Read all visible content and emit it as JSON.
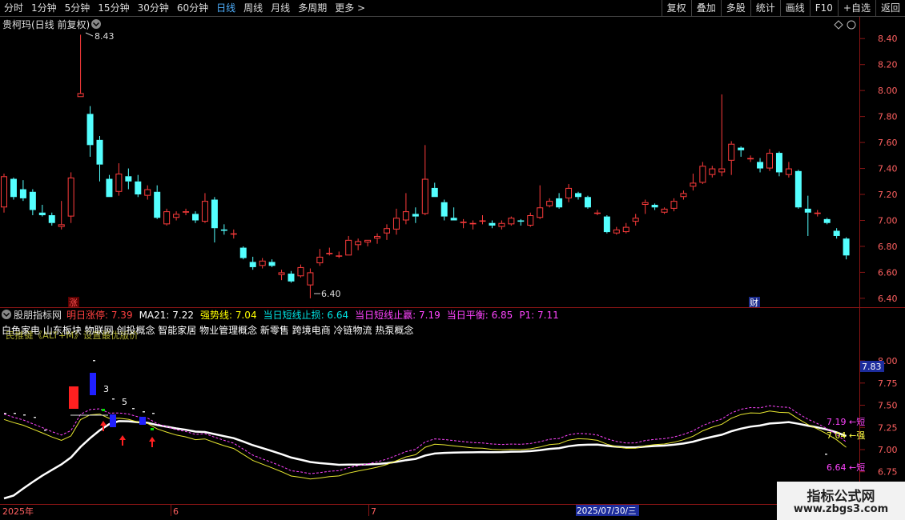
{
  "toolbar": {
    "periods": [
      "分时",
      "1分钟",
      "5分钟",
      "15分钟",
      "30分钟",
      "60分钟",
      "日线",
      "周线",
      "月线",
      "多周期",
      "更多 >"
    ],
    "active": "日线",
    "right_buttons": [
      "复权",
      "叠加",
      "多股",
      "统计",
      "画线",
      "F10",
      "+自选",
      "返回"
    ]
  },
  "main_chart": {
    "title": "贵柯玛(日线 前复权)",
    "dropdown_icon": "chevron-down-icon",
    "y_ticks": [
      "8.40",
      "8.20",
      "8.00",
      "7.80",
      "7.60",
      "7.40",
      "7.20",
      "7.00",
      "6.80",
      "6.60",
      "6.40"
    ],
    "high_label": "8.43",
    "low_label": "6.40",
    "marker_zhang": "涨",
    "marker_cai": "财",
    "colors": {
      "up": "#ff3c3c",
      "down": "#54ffff",
      "grid": "#7a1010"
    }
  },
  "chart_data": {
    "type": "candlestick",
    "ylim": [
      6.35,
      8.5
    ],
    "candles": [
      {
        "o": 7.1,
        "h": 7.36,
        "l": 7.06,
        "c": 7.34
      },
      {
        "o": 7.32,
        "h": 7.33,
        "l": 7.16,
        "c": 7.18
      },
      {
        "o": 7.24,
        "h": 7.31,
        "l": 7.15,
        "c": 7.17
      },
      {
        "o": 7.22,
        "h": 7.24,
        "l": 7.04,
        "c": 7.08
      },
      {
        "o": 7.06,
        "h": 7.12,
        "l": 7.03,
        "c": 7.04
      },
      {
        "o": 7.04,
        "h": 7.06,
        "l": 6.96,
        "c": 6.98
      },
      {
        "o": 6.95,
        "h": 7.15,
        "l": 6.93,
        "c": 6.97
      },
      {
        "o": 7.03,
        "h": 7.37,
        "l": 6.98,
        "c": 7.33
      },
      {
        "o": 7.95,
        "h": 8.43,
        "l": 7.95,
        "c": 7.98
      },
      {
        "o": 7.82,
        "h": 7.88,
        "l": 7.49,
        "c": 7.58
      },
      {
        "o": 7.62,
        "h": 7.65,
        "l": 7.3,
        "c": 7.43
      },
      {
        "o": 7.32,
        "h": 7.35,
        "l": 7.18,
        "c": 7.18
      },
      {
        "o": 7.22,
        "h": 7.44,
        "l": 7.19,
        "c": 7.36
      },
      {
        "o": 7.34,
        "h": 7.4,
        "l": 7.24,
        "c": 7.3
      },
      {
        "o": 7.3,
        "h": 7.35,
        "l": 7.18,
        "c": 7.2
      },
      {
        "o": 7.19,
        "h": 7.27,
        "l": 7.16,
        "c": 7.24
      },
      {
        "o": 7.22,
        "h": 7.27,
        "l": 7.01,
        "c": 7.02
      },
      {
        "o": 6.97,
        "h": 7.09,
        "l": 6.96,
        "c": 7.07
      },
      {
        "o": 7.02,
        "h": 7.07,
        "l": 7.0,
        "c": 7.05
      },
      {
        "o": 7.06,
        "h": 7.09,
        "l": 7.04,
        "c": 7.07
      },
      {
        "o": 7.05,
        "h": 7.07,
        "l": 6.98,
        "c": 7.0
      },
      {
        "o": 6.99,
        "h": 7.21,
        "l": 6.98,
        "c": 7.15
      },
      {
        "o": 7.16,
        "h": 7.18,
        "l": 6.83,
        "c": 6.94
      },
      {
        "o": 6.93,
        "h": 6.97,
        "l": 6.89,
        "c": 6.92
      },
      {
        "o": 6.9,
        "h": 6.93,
        "l": 6.86,
        "c": 6.9
      },
      {
        "o": 6.79,
        "h": 6.8,
        "l": 6.7,
        "c": 6.71
      },
      {
        "o": 6.68,
        "h": 6.72,
        "l": 6.62,
        "c": 6.64
      },
      {
        "o": 6.65,
        "h": 6.71,
        "l": 6.63,
        "c": 6.69
      },
      {
        "o": 6.68,
        "h": 6.7,
        "l": 6.64,
        "c": 6.65
      },
      {
        "o": 6.58,
        "h": 6.62,
        "l": 6.54,
        "c": 6.6
      },
      {
        "o": 6.59,
        "h": 6.61,
        "l": 6.52,
        "c": 6.53
      },
      {
        "o": 6.57,
        "h": 6.66,
        "l": 6.56,
        "c": 6.64
      },
      {
        "o": 6.5,
        "h": 6.63,
        "l": 6.4,
        "c": 6.6
      },
      {
        "o": 6.67,
        "h": 6.78,
        "l": 6.65,
        "c": 6.72
      },
      {
        "o": 6.74,
        "h": 6.79,
        "l": 6.73,
        "c": 6.75
      },
      {
        "o": 6.73,
        "h": 6.76,
        "l": 6.71,
        "c": 6.73
      },
      {
        "o": 6.73,
        "h": 6.88,
        "l": 6.73,
        "c": 6.85
      },
      {
        "o": 6.81,
        "h": 6.86,
        "l": 6.77,
        "c": 6.84
      },
      {
        "o": 6.83,
        "h": 6.85,
        "l": 6.8,
        "c": 6.85
      },
      {
        "o": 6.86,
        "h": 6.9,
        "l": 6.82,
        "c": 6.88
      },
      {
        "o": 6.9,
        "h": 6.97,
        "l": 6.85,
        "c": 6.94
      },
      {
        "o": 6.93,
        "h": 7.09,
        "l": 6.89,
        "c": 7.02
      },
      {
        "o": 7.0,
        "h": 7.21,
        "l": 6.97,
        "c": 7.07
      },
      {
        "o": 7.05,
        "h": 7.1,
        "l": 6.98,
        "c": 7.03
      },
      {
        "o": 7.05,
        "h": 7.58,
        "l": 7.04,
        "c": 7.32
      },
      {
        "o": 7.25,
        "h": 7.29,
        "l": 7.18,
        "c": 7.18
      },
      {
        "o": 7.14,
        "h": 7.16,
        "l": 7.0,
        "c": 7.03
      },
      {
        "o": 7.02,
        "h": 7.1,
        "l": 7.0,
        "c": 7.0
      },
      {
        "o": 6.98,
        "h": 7.01,
        "l": 6.94,
        "c": 6.99
      },
      {
        "o": 6.97,
        "h": 7.0,
        "l": 6.93,
        "c": 6.98
      },
      {
        "o": 6.99,
        "h": 7.04,
        "l": 6.97,
        "c": 7.0
      },
      {
        "o": 6.98,
        "h": 7.0,
        "l": 6.94,
        "c": 6.96
      },
      {
        "o": 6.95,
        "h": 7.0,
        "l": 6.93,
        "c": 6.98
      },
      {
        "o": 6.97,
        "h": 7.03,
        "l": 6.96,
        "c": 7.02
      },
      {
        "o": 7.0,
        "h": 7.01,
        "l": 6.96,
        "c": 6.99
      },
      {
        "o": 6.96,
        "h": 7.06,
        "l": 6.95,
        "c": 7.04
      },
      {
        "o": 7.02,
        "h": 7.27,
        "l": 7.01,
        "c": 7.1
      },
      {
        "o": 7.11,
        "h": 7.17,
        "l": 7.1,
        "c": 7.15
      },
      {
        "o": 7.17,
        "h": 7.21,
        "l": 7.09,
        "c": 7.1
      },
      {
        "o": 7.17,
        "h": 7.28,
        "l": 7.14,
        "c": 7.25
      },
      {
        "o": 7.21,
        "h": 7.22,
        "l": 7.16,
        "c": 7.18
      },
      {
        "o": 7.18,
        "h": 7.19,
        "l": 7.09,
        "c": 7.1
      },
      {
        "o": 7.06,
        "h": 7.08,
        "l": 7.04,
        "c": 7.06
      },
      {
        "o": 7.03,
        "h": 7.04,
        "l": 6.9,
        "c": 6.91
      },
      {
        "o": 6.9,
        "h": 6.95,
        "l": 6.89,
        "c": 6.93
      },
      {
        "o": 6.91,
        "h": 6.98,
        "l": 6.9,
        "c": 6.95
      },
      {
        "o": 6.99,
        "h": 7.05,
        "l": 6.96,
        "c": 7.02
      },
      {
        "o": 7.12,
        "h": 7.16,
        "l": 7.05,
        "c": 7.14
      },
      {
        "o": 7.12,
        "h": 7.13,
        "l": 7.08,
        "c": 7.1
      },
      {
        "o": 7.06,
        "h": 7.1,
        "l": 7.05,
        "c": 7.09
      },
      {
        "o": 7.09,
        "h": 7.17,
        "l": 7.07,
        "c": 7.15
      },
      {
        "o": 7.18,
        "h": 7.23,
        "l": 7.16,
        "c": 7.21
      },
      {
        "o": 7.26,
        "h": 7.36,
        "l": 7.23,
        "c": 7.29
      },
      {
        "o": 7.29,
        "h": 7.45,
        "l": 7.28,
        "c": 7.42
      },
      {
        "o": 7.35,
        "h": 7.42,
        "l": 7.33,
        "c": 7.4
      },
      {
        "o": 7.37,
        "h": 7.97,
        "l": 7.34,
        "c": 7.4
      },
      {
        "o": 7.46,
        "h": 7.61,
        "l": 7.35,
        "c": 7.59
      },
      {
        "o": 7.56,
        "h": 7.57,
        "l": 7.49,
        "c": 7.54
      },
      {
        "o": 7.47,
        "h": 7.5,
        "l": 7.45,
        "c": 7.48
      },
      {
        "o": 7.45,
        "h": 7.48,
        "l": 7.37,
        "c": 7.4
      },
      {
        "o": 7.4,
        "h": 7.55,
        "l": 7.38,
        "c": 7.52
      },
      {
        "o": 7.52,
        "h": 7.53,
        "l": 7.34,
        "c": 7.37
      },
      {
        "o": 7.35,
        "h": 7.45,
        "l": 7.33,
        "c": 7.4
      },
      {
        "o": 7.38,
        "h": 7.39,
        "l": 7.09,
        "c": 7.1
      },
      {
        "o": 7.09,
        "h": 7.19,
        "l": 6.88,
        "c": 7.06
      },
      {
        "o": 7.05,
        "h": 7.08,
        "l": 7.03,
        "c": 7.06
      },
      {
        "o": 7.01,
        "h": 7.02,
        "l": 6.97,
        "c": 6.98
      },
      {
        "o": 6.92,
        "h": 6.94,
        "l": 6.86,
        "c": 6.88
      },
      {
        "o": 6.86,
        "h": 6.87,
        "l": 6.7,
        "c": 6.73
      }
    ]
  },
  "indicator": {
    "name": "股朋指标网",
    "items": [
      {
        "text": "明日涨停: 7.39",
        "color": "#ff4040"
      },
      {
        "text": "MA21: 7.22",
        "color": "#ffffff"
      },
      {
        "text": "强势线: 7.04",
        "color": "#ffff00"
      },
      {
        "text": "当日短线止损: 6.64",
        "color": "#00e5e5"
      },
      {
        "text": "当日短线止赢: 7.19",
        "color": "#ff44ff"
      },
      {
        "text": "当日平衡: 6.85",
        "color": "#ff44ff"
      },
      {
        "text": "P1: 7.11",
        "color": "#ff44ff"
      }
    ],
    "concepts": "白色家电 山东板块 物联网 创投概念 智能家居 物业管理概念 新零售 跨境电商 冷链物流 热泵概念",
    "overlay_text": "民推键《ALT+M》设置最优版价",
    "y_ticks": [
      "8.00",
      "7.75",
      "7.50",
      "7.25",
      "7.00",
      "6.75"
    ],
    "current_value": "7.83",
    "right_labels": [
      {
        "text": "7.19 ←短",
        "color": "#ff44ff"
      },
      {
        "text": "7.04 ←强",
        "color": "#ffff44"
      },
      {
        "text": "6.64 ←短",
        "color": "#ff44ff"
      }
    ],
    "small_labels": [
      "3",
      "5"
    ],
    "ylim": [
      6.45,
      8.1
    ]
  },
  "date_axis": {
    "labels": [
      "2025年",
      "6",
      "7"
    ],
    "cursor_date": "2025/07/30/三"
  },
  "watermark": {
    "line1": "指标公式网",
    "line2": "www.zbgs3.com"
  }
}
